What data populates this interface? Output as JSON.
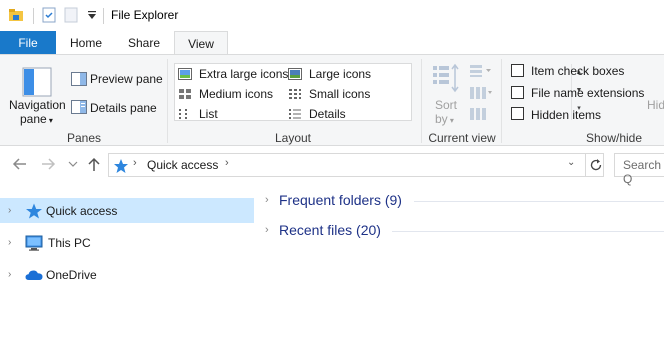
{
  "window": {
    "title": "File Explorer"
  },
  "tabs": [
    {
      "label": "File"
    },
    {
      "label": "Home"
    },
    {
      "label": "Share"
    },
    {
      "label": "View"
    }
  ],
  "ribbon": {
    "panes": {
      "navigation_pane_line1": "Navigation",
      "navigation_pane_line2": "pane",
      "preview_pane": "Preview pane",
      "details_pane": "Details pane",
      "group_label": "Panes"
    },
    "layout": {
      "items": [
        {
          "label": "Extra large icons"
        },
        {
          "label": "Large icons"
        },
        {
          "label": "Medium icons"
        },
        {
          "label": "Small icons"
        },
        {
          "label": "List"
        },
        {
          "label": "Details"
        }
      ],
      "group_label": "Layout"
    },
    "current_view": {
      "sort_line1": "Sort",
      "sort_line2": "by",
      "group_label": "Current view"
    },
    "show_hide": {
      "item_check_boxes": "Item check boxes",
      "file_name_extensions": "File name extensions",
      "hidden_items": "Hidden items",
      "hide_selected": "Hid",
      "group_label": "Show/hide"
    }
  },
  "address": {
    "location": "Quick access",
    "search_placeholder": "Search Q"
  },
  "nav_pane": {
    "items": [
      {
        "label": "Quick access",
        "selected": true
      },
      {
        "label": "This PC"
      },
      {
        "label": "OneDrive"
      }
    ]
  },
  "content": {
    "groups": [
      {
        "label": "Frequent folders (9)"
      },
      {
        "label": "Recent files (20)"
      }
    ]
  },
  "colors": {
    "file_tab": "#1979ca",
    "selection": "#cce8ff",
    "group_header": "#1e3287",
    "ribbon_bg": "#f5f6f7"
  }
}
